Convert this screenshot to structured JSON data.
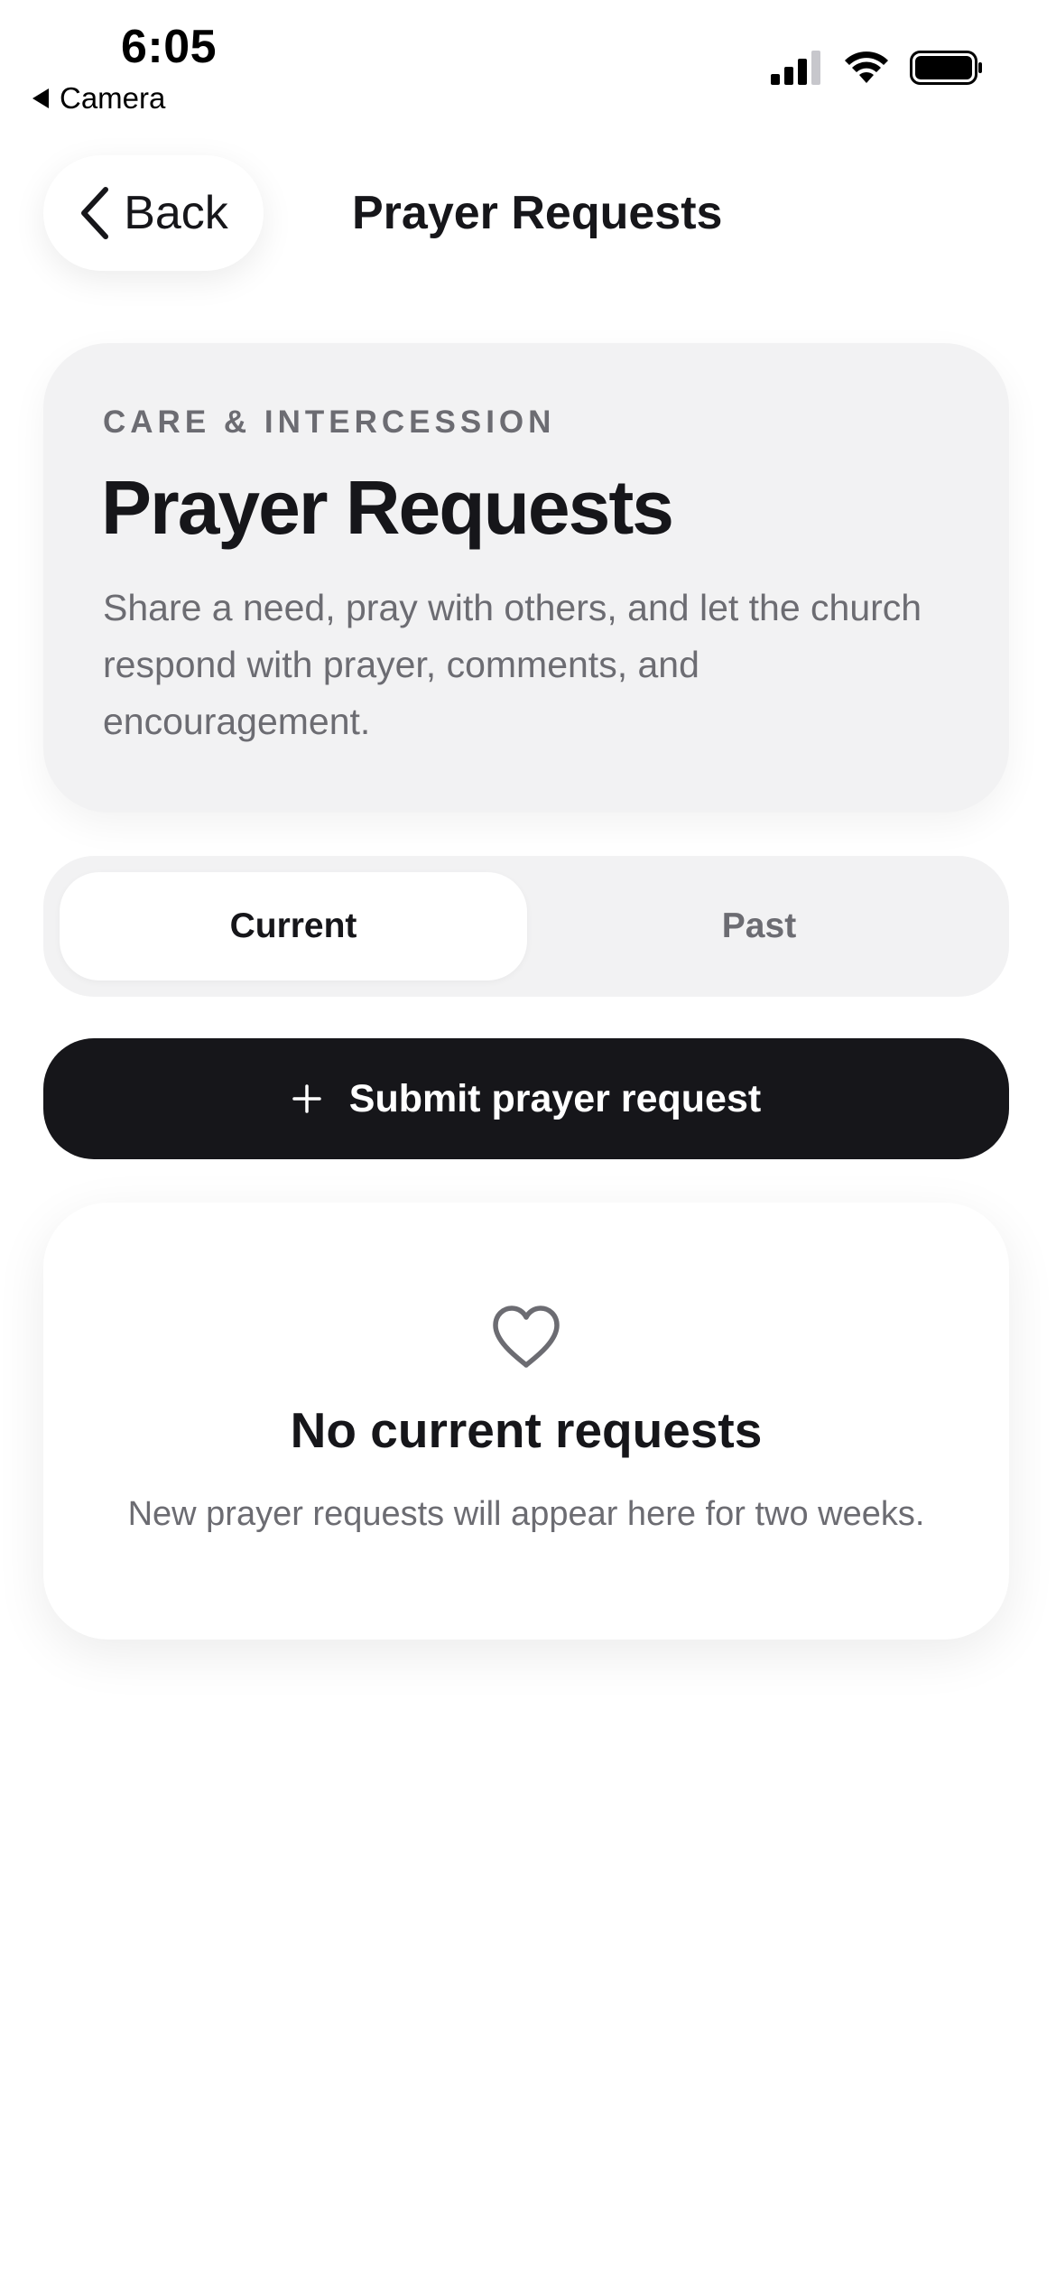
{
  "status_bar": {
    "time": "6:05",
    "back_app": "Camera",
    "icons": [
      "cellular-signal-icon",
      "wifi-icon",
      "battery-icon"
    ]
  },
  "nav": {
    "back_label": "Back",
    "title": "Prayer Requests"
  },
  "hero": {
    "eyebrow": "CARE & INTERCESSION",
    "title": "Prayer Requests",
    "description": "Share a need, pray with others, and let the church respond with prayer, comments, and encouragement."
  },
  "tabs": {
    "items": [
      {
        "label": "Current",
        "selected": true
      },
      {
        "label": "Past",
        "selected": false
      }
    ]
  },
  "submit": {
    "icon": "plus-icon",
    "label": "Submit prayer request"
  },
  "empty_state": {
    "icon": "heart-outline-icon",
    "title": "No current requests",
    "subtitle": "New prayer requests will appear here for two weeks."
  },
  "colors": {
    "text_primary": "#16161a",
    "text_secondary": "#6c6c72",
    "card_background": "#f2f2f3",
    "button_background": "#16161a"
  }
}
